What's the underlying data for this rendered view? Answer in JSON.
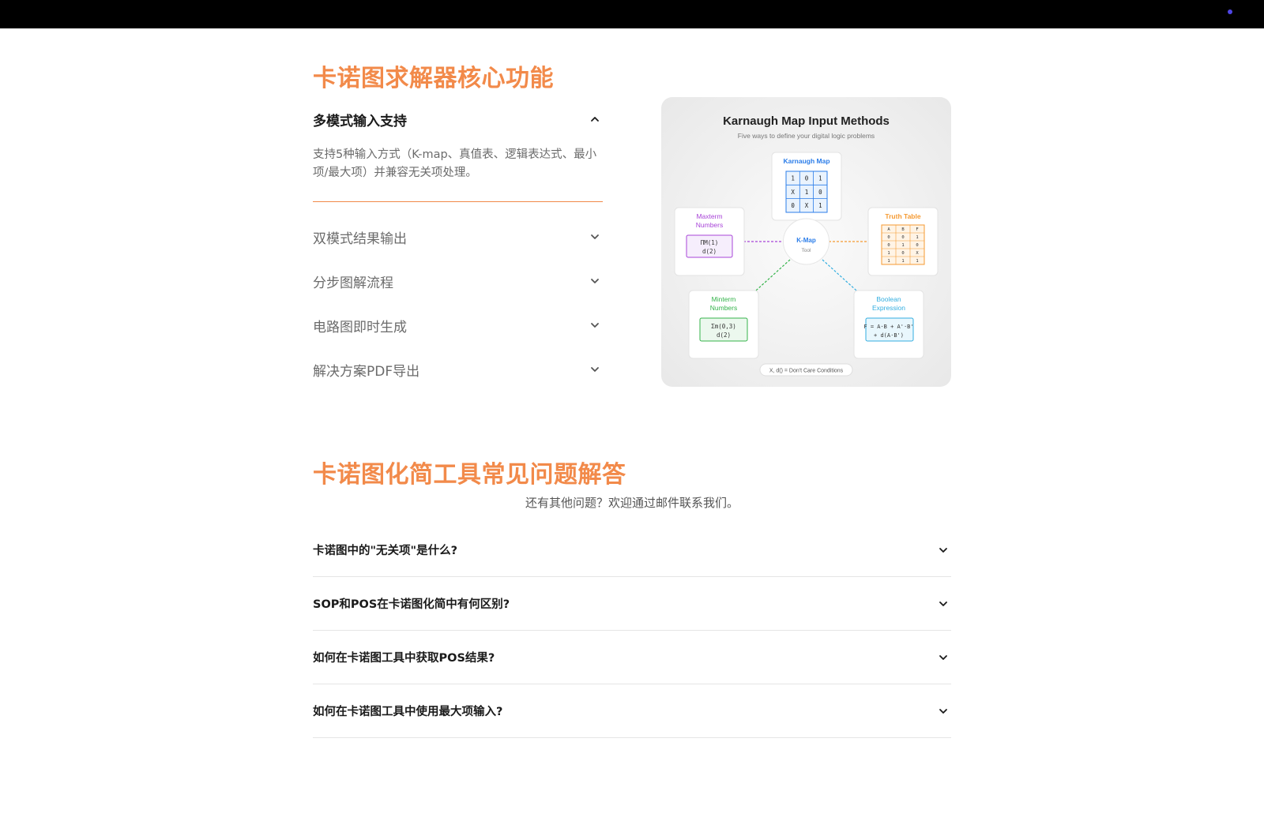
{
  "features": {
    "title": "卡诺图求解器核心功能",
    "items": [
      {
        "label": "多模式输入支持",
        "expanded": true,
        "body": "支持5种输入方式（K-map、真值表、逻辑表达式、最小项/最大项）并兼容无关项处理。"
      },
      {
        "label": "双模式结果输出",
        "expanded": false
      },
      {
        "label": "分步图解流程",
        "expanded": false
      },
      {
        "label": "电路图即时生成",
        "expanded": false
      },
      {
        "label": "解决方案PDF导出",
        "expanded": false
      }
    ]
  },
  "illustration": {
    "title": "Karnaugh Map Input Methods",
    "subtitle": "Five ways to define your digital logic problems",
    "center": {
      "title": "K-Map",
      "sub": "Tool"
    },
    "kmap": {
      "label": "Karnaugh Map",
      "cells": [
        [
          "1",
          "0",
          "1"
        ],
        [
          "X",
          "1",
          "0"
        ],
        [
          "0",
          "X",
          "1"
        ]
      ]
    },
    "truth": {
      "label": "Truth Table",
      "rows": [
        [
          "A",
          "B",
          "F"
        ],
        [
          "0",
          "0",
          "1"
        ],
        [
          "0",
          "1",
          "0"
        ],
        [
          "1",
          "0",
          "X"
        ],
        [
          "1",
          "1",
          "1"
        ]
      ]
    },
    "maxterm": {
      "label1": "Maxterm",
      "label2": "Numbers",
      "line1": "ΠM(1)",
      "line2": "d(2)"
    },
    "minterm": {
      "label1": "Minterm",
      "label2": "Numbers",
      "line1": "Σm(0,3)",
      "line2": "d(2)"
    },
    "boolean": {
      "label1": "Boolean",
      "label2": "Expression",
      "line1": "F = A·B + A'·B'",
      "line2": "+ d(A·B')"
    },
    "footnote": "X, d() = Don't Care Conditions",
    "colors": {
      "kmap": "#2b7de9",
      "truth": "#f59a32",
      "maxterm": "#a844d8",
      "minterm": "#34b34a",
      "boolean": "#33aee0"
    }
  },
  "faq": {
    "title": "卡诺图化简工具常见问题解答",
    "subtitle": "还有其他问题？欢迎通过邮件联系我们。",
    "items": [
      {
        "q": "卡诺图中的\"无关项\"是什么?"
      },
      {
        "q": "SOP和POS在卡诺图化简中有何区别?"
      },
      {
        "q": "如何在卡诺图工具中获取POS结果?"
      },
      {
        "q": "如何在卡诺图工具中使用最大项输入?"
      }
    ]
  },
  "accent_color": "#f28a4a"
}
